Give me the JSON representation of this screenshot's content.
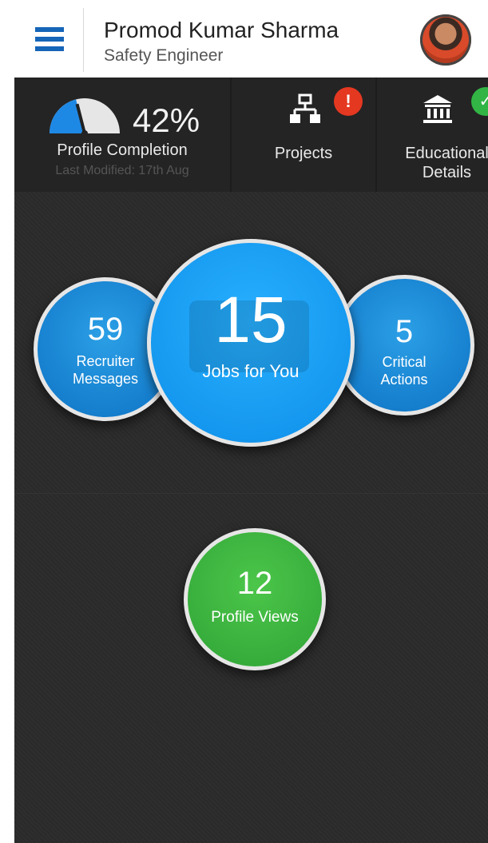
{
  "header": {
    "name": "Promod Kumar Sharma",
    "title": "Safety Engineer",
    "menu_icon": "hamburger-menu-icon",
    "avatar_icon": "user-avatar"
  },
  "stats": {
    "profile": {
      "percent": "42%",
      "percent_value": 0.42,
      "label": "Profile Completion",
      "last_modified": "Last Modified: 17th Aug"
    },
    "projects": {
      "label": "Projects",
      "badge": "!",
      "icon": "hierarchy-icon"
    },
    "education": {
      "label_line1": "Educational",
      "label_line2": "Details",
      "icon": "institution-icon"
    }
  },
  "bubbles": {
    "recruiter": {
      "count": "59",
      "line1": "Recruiter",
      "line2": "Messages"
    },
    "jobs": {
      "count": "15",
      "label": "Jobs for You"
    },
    "critical": {
      "count": "5",
      "line1": "Critical",
      "line2": "Actions"
    },
    "views": {
      "count": "12",
      "label": "Profile Views"
    }
  },
  "colors": {
    "accent_blue": "#1565b8",
    "bubble_blue": "#0d8ee8",
    "bubble_green": "#32b545",
    "badge_red": "#e53821"
  }
}
